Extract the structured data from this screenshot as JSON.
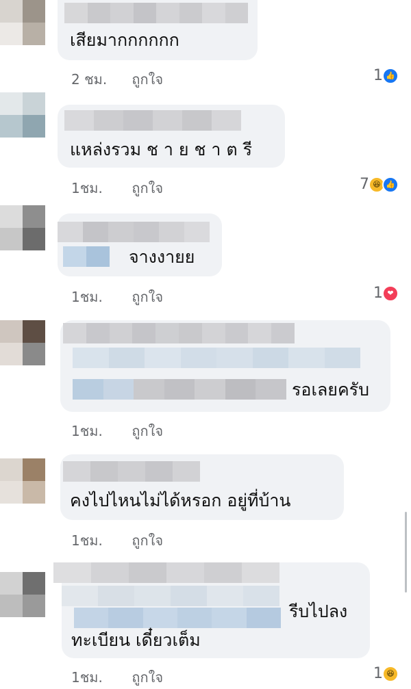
{
  "comments": [
    {
      "text": "เสียมากกกกกก",
      "time": "2 ชม.",
      "like_label": "ถูกใจ",
      "reaction_count": "1",
      "reaction_icons": [
        "like-icon"
      ]
    },
    {
      "text": "แหล่งรวม ช า ย ช า ต รี",
      "time": "1ชม.",
      "like_label": "ถูกใจ",
      "reaction_count": "7",
      "reaction_icons": [
        "haha-icon",
        "like-icon"
      ]
    },
    {
      "text": "จางงายย",
      "time": "1ชม.",
      "like_label": "ถูกใจ",
      "reaction_count": "1",
      "reaction_icons": [
        "love-icon"
      ]
    },
    {
      "text": "รอเลยครับ",
      "time": "1ชม.",
      "like_label": "ถูกใจ",
      "reaction_count": "",
      "reaction_icons": []
    },
    {
      "text": "คงไปไหนไม่ได้หรอก อยู่ที่บ้าน",
      "time": "1ชม.",
      "like_label": "ถูกใจ",
      "reaction_count": "",
      "reaction_icons": []
    },
    {
      "text_line1": "รีบไปลง",
      "text_line2": "ทะเบียน เดี๋ยวเต็ม",
      "time": "1ชม.",
      "like_label": "ถูกใจ",
      "reaction_count": "1",
      "reaction_icons": [
        "haha-icon"
      ]
    }
  ],
  "colors": {
    "bubble": "#f0f2f5",
    "meta_text": "#65676b",
    "like_blue": "#1877f2",
    "love_red": "#f33e58",
    "haha_yellow": "#f7b928"
  }
}
